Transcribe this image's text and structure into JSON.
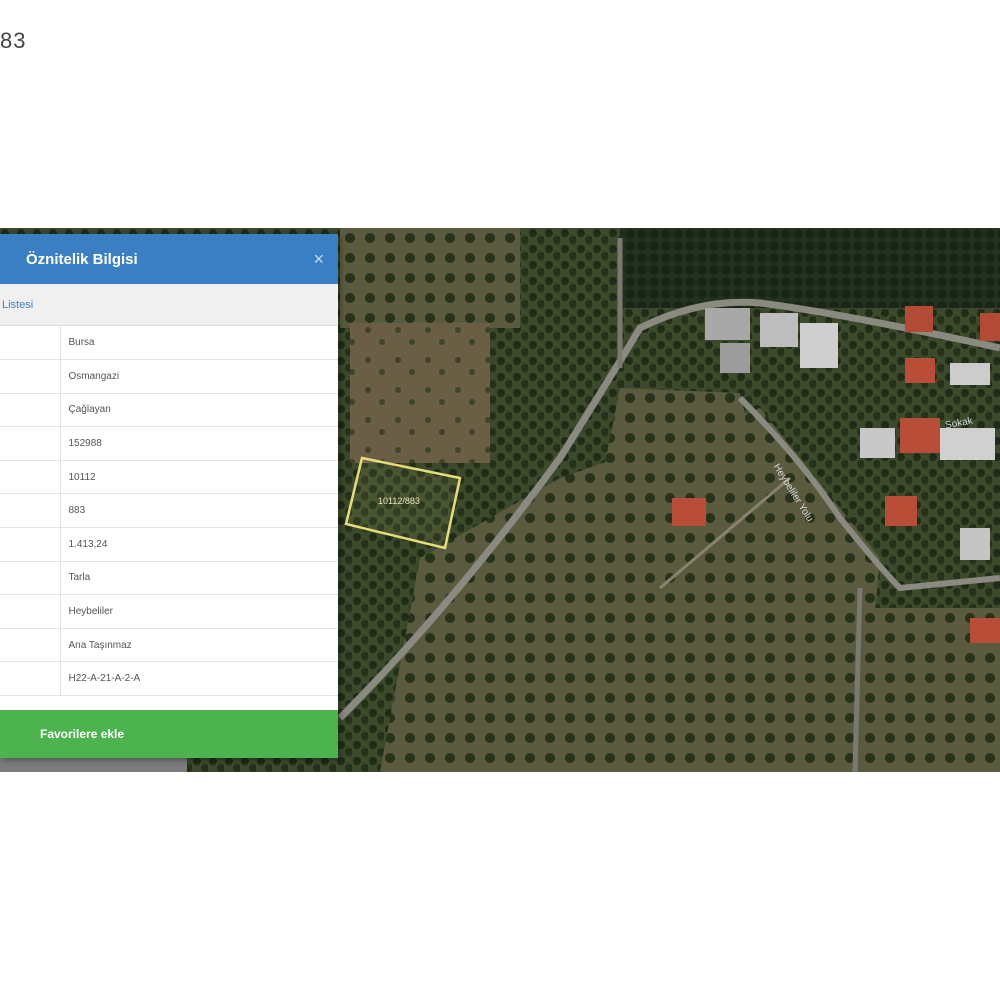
{
  "header_fragment": "83",
  "panel": {
    "title": "Öznitelik Bilgisi",
    "close_glyph": "×",
    "subtitle": "Listesi",
    "rows": [
      {
        "value": "Bursa"
      },
      {
        "value": "Osmangazi"
      },
      {
        "value": "Çağlayan"
      },
      {
        "value": "152988"
      },
      {
        "value": "10112"
      },
      {
        "value": "883"
      },
      {
        "value": "1.413,24"
      },
      {
        "value": "Tarla"
      },
      {
        "value": "Heybeliler"
      },
      {
        "value": "Ana Taşınmaz"
      },
      {
        "value": "H22-A-21-A-2-A"
      }
    ],
    "action_label": "Favorilere ekle"
  },
  "map": {
    "parcel_label": "10112/883",
    "road_label_1": "Heybeliler Yolu",
    "road_label_2": "Sokak",
    "parcel_outline_color": "#e6dc7a",
    "header_color": "#3a7fc4",
    "button_color": "#4cb34f"
  }
}
